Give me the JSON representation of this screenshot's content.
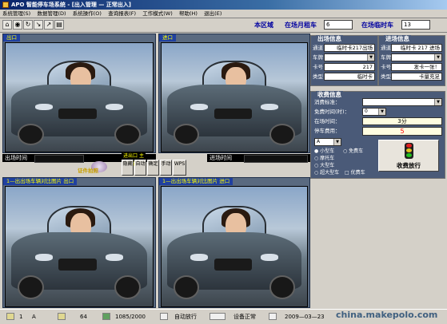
{
  "window": {
    "title": "APO 智能停车场系统 - [出入管理 — 正常出入]"
  },
  "menu": [
    "系统管理(S)",
    "数据管理(D)",
    "系统操作(O)",
    "查询报表(F)",
    "工作模式(W)",
    "帮助(H)",
    "退出(E)"
  ],
  "toolbar": {
    "district": "本区域",
    "monthly_label": "在场月租车",
    "monthly_value": "6",
    "temp_label": "在场临时车",
    "temp_value": "13"
  },
  "cameras": {
    "exit_top": "出口",
    "entry_top": "进口",
    "exit_bottom": "1—出出场车辆对比图片 出口",
    "entry_bottom": "1—出出场车辆对比图片 进口"
  },
  "timebars": {
    "exit_time": "出场时间",
    "entry_time": "进场时间"
  },
  "controls": {
    "top_label": "进出口 主窗",
    "capture_label": "证件拍照",
    "small_buttons": [
      "隐藏",
      "自动",
      "确定",
      "手动",
      "WPS"
    ]
  },
  "exit_info": {
    "title": "出场信息",
    "rows": [
      {
        "label": "通道",
        "value": "临时卡217出场"
      },
      {
        "label": "车牌",
        "value": ""
      },
      {
        "label": "卡号",
        "value": "217"
      },
      {
        "label": "类型",
        "value": "临时卡"
      }
    ]
  },
  "entry_info": {
    "title": "进场信息",
    "rows": [
      {
        "label": "通道",
        "value": "临时卡 217 进场"
      },
      {
        "label": "车牌",
        "value": ""
      },
      {
        "label": "卡号",
        "value": "发卡一张！"
      },
      {
        "label": "类型",
        "value": "卡量充足"
      }
    ]
  },
  "fee_info": {
    "title": "收费信息",
    "standard_label": "消费标准：",
    "free_time_label": "免费时间(时)：",
    "free_time_value": "0",
    "duration_label": "在场时间：",
    "duration_value": "3分",
    "fee_label": "停车费用：",
    "fee_value": "5",
    "select_value": "A",
    "radios": [
      "小型车",
      "免费车",
      "摩托车",
      "大型车",
      "大型车",
      "超大型车"
    ],
    "checkbox_label": "优费车",
    "release_button": "收费放行"
  },
  "status": {
    "slot": "1",
    "mode": "A",
    "count": "64",
    "ratio": "1085/2000",
    "auto_release": "自动放行",
    "device": "设备正常",
    "date": "2009—03—23",
    "watermark": "china.makepolo.com"
  },
  "colors": {
    "panel": "#5a6a80",
    "title_blue": "#0000a0",
    "fee_red": "#ff0000"
  }
}
